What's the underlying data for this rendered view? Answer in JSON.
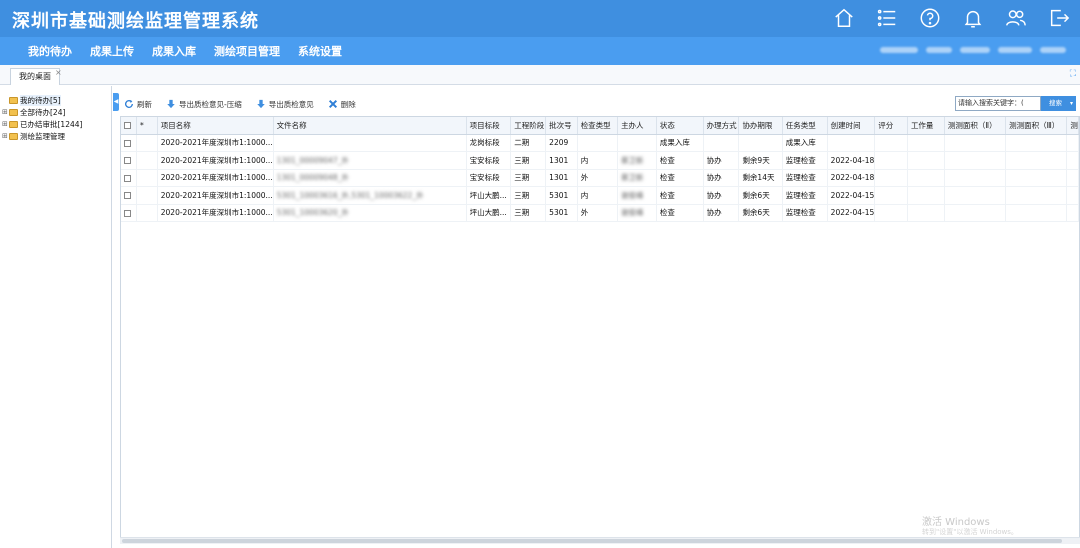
{
  "app": {
    "title": "深圳市基础测绘监理管理系统"
  },
  "top_icons": [
    "home-icon",
    "list-icon",
    "help-icon",
    "bell-icon",
    "users-icon",
    "logout-icon"
  ],
  "nav": {
    "items": [
      "我的待办",
      "成果上传",
      "成果入库",
      "测绘项目管理",
      "系统设置"
    ]
  },
  "tabs": [
    {
      "label": "我的桌面",
      "close": "×"
    }
  ],
  "sidebar": {
    "items": [
      {
        "label": "我的待办[5]",
        "expandable": false,
        "selected": true
      },
      {
        "label": "全部待办[24]",
        "expandable": true,
        "selected": false
      },
      {
        "label": "已办结审批[1244]",
        "expandable": true,
        "selected": false
      },
      {
        "label": "测绘监理管理",
        "expandable": true,
        "selected": false
      }
    ]
  },
  "toolbar": {
    "refresh": "刷新",
    "export_compressed": "导出质检意见-压缩",
    "export": "导出质检意见",
    "delete": "删除"
  },
  "search": {
    "placeholder": "请输入搜索关键字：(",
    "button": "搜索"
  },
  "table": {
    "columns": [
      "",
      "*",
      "项目名称",
      "文件名称",
      "项目标段",
      "工程阶段",
      "批次号",
      "检查类型",
      "主办人",
      "状态",
      "办理方式",
      "协办期限",
      "任务类型",
      "创建时间",
      "评分",
      "工作量",
      "测测面积（Ⅱ）",
      "测测面积（Ⅲ）",
      "测"
    ],
    "rows": [
      [
        "",
        "",
        "2020-2021年度深圳市1:1000...",
        "",
        "龙岗标段",
        "二期",
        "2209",
        "",
        "",
        "成果入库",
        "",
        "",
        "成果入库",
        "",
        "",
        "",
        "",
        "",
        ""
      ],
      [
        "",
        "",
        "2020-2021年度深圳市1:1000...",
        "1301_00009047_外",
        "宝安标段",
        "三期",
        "1301",
        "内",
        "蔡卫新",
        "检查",
        "协办",
        "剩余9天",
        "监理检查",
        "2022-04-18",
        "",
        "",
        "",
        "",
        ""
      ],
      [
        "",
        "",
        "2020-2021年度深圳市1:1000...",
        "1301_00009048_外",
        "宝安标段",
        "三期",
        "1301",
        "外",
        "蔡卫新",
        "检查",
        "协办",
        "剩余14天",
        "监理检查",
        "2022-04-18",
        "",
        "",
        "",
        "",
        ""
      ],
      [
        "",
        "",
        "2020-2021年度深圳市1:1000...",
        "5301_10003616_外,5301_10003622_外",
        "坪山大鹏...",
        "三期",
        "5301",
        "内",
        "谢俊峰",
        "检查",
        "协办",
        "剩余6天",
        "监理检查",
        "2022-04-15",
        "",
        "",
        "",
        "",
        ""
      ],
      [
        "",
        "",
        "2020-2021年度深圳市1:1000...",
        "5301_10003620_外",
        "坪山大鹏...",
        "三期",
        "5301",
        "外",
        "谢俊峰",
        "检查",
        "协办",
        "剩余6天",
        "监理检查",
        "2022-04-15",
        "",
        "",
        "",
        "",
        ""
      ]
    ],
    "blurred_columns": [
      3,
      8
    ]
  },
  "watermark": {
    "line1": "激活 Windows",
    "line2": "转到\"设置\"以激活 Windows。"
  },
  "colors": {
    "header": "#3f8fe0",
    "navbar": "#4a9df0",
    "accent": "#3f8fe0"
  }
}
